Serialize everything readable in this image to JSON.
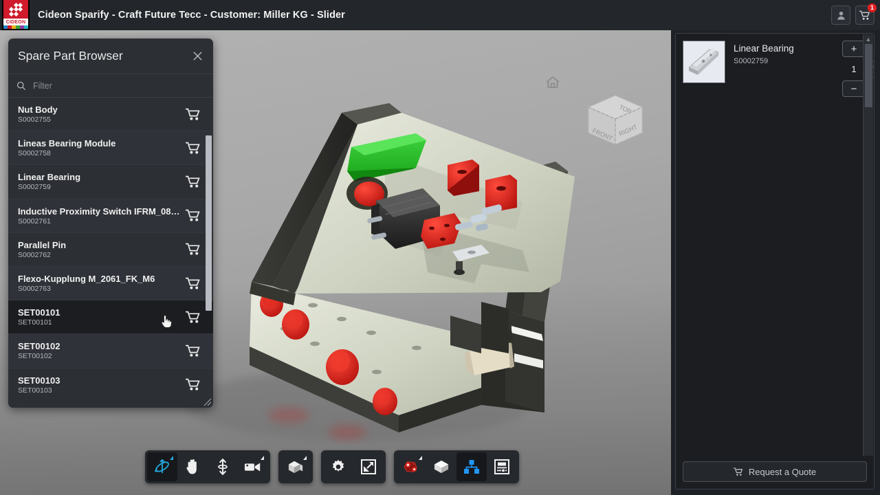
{
  "titlebar": {
    "app_title": "Cideon Sparify - Craft Future Tecc - Customer: Miller KG - Slider",
    "logo_word": "CIDEON",
    "user_button_name": "user-account-button",
    "cart_button_name": "cart-button",
    "cart_badge_count": "1"
  },
  "browser": {
    "title": "Spare Part Browser",
    "close_label": "✕",
    "filter_placeholder": "Filter",
    "filter_value": "",
    "parts": [
      {
        "name": "Nut Body",
        "id": "S0002755",
        "selected": false
      },
      {
        "name": "Lineas Bearing Module",
        "id": "S0002758",
        "selected": false
      },
      {
        "name": "Linear Bearing",
        "id": "S0002759",
        "selected": false
      },
      {
        "name": "Inductive Proximity Switch IFRM_08…",
        "id": "S0002761",
        "selected": false
      },
      {
        "name": "Parallel Pin",
        "id": "S0002762",
        "selected": false
      },
      {
        "name": "Flexo-Kupplung M_2061_FK_M6",
        "id": "S0002763",
        "selected": false
      },
      {
        "name": "SET00101",
        "id": "SET00101",
        "selected": true
      },
      {
        "name": "SET00102",
        "id": "SET00102",
        "selected": false
      },
      {
        "name": "SET00103",
        "id": "SET00103",
        "selected": false
      }
    ]
  },
  "viewport": {
    "home_icon": "home-icon",
    "viewcube": {
      "top": "TOP",
      "front": "FRONT",
      "right": "RIGHT"
    }
  },
  "toolbar": {
    "groups": [
      {
        "name": "navigation-tools",
        "buttons": [
          {
            "name": "orbit-tool",
            "icon": "orbit-icon",
            "active": true,
            "accent": true,
            "has_dropdown": true
          },
          {
            "name": "pan-tool",
            "icon": "hand-icon",
            "active": false,
            "accent": false,
            "has_dropdown": false
          },
          {
            "name": "zoom-tool",
            "icon": "zoom-vertical-arrow-icon",
            "active": false,
            "accent": false,
            "has_dropdown": false
          },
          {
            "name": "camera-tool",
            "icon": "camera-icon",
            "active": false,
            "accent": false,
            "has_dropdown": true
          }
        ]
      },
      {
        "name": "view-style-tools",
        "buttons": [
          {
            "name": "display-mode-tool",
            "icon": "shaded-box-icon",
            "active": false,
            "accent": false,
            "has_dropdown": true
          }
        ]
      },
      {
        "name": "settings-tools",
        "buttons": [
          {
            "name": "settings-tool",
            "icon": "gear-icon",
            "active": false,
            "accent": false,
            "has_dropdown": false
          },
          {
            "name": "fullscreen-tool",
            "icon": "expand-arrow-icon",
            "active": false,
            "accent": false,
            "has_dropdown": false
          }
        ]
      },
      {
        "name": "model-tools",
        "buttons": [
          {
            "name": "explode-tool",
            "icon": "explode-parts-icon",
            "active": false,
            "accent": false,
            "has_dropdown": true
          },
          {
            "name": "isolate-tool",
            "icon": "cube-icon",
            "active": false,
            "accent": false,
            "has_dropdown": false
          },
          {
            "name": "structure-tree-tool",
            "icon": "structure-tree-icon",
            "active": true,
            "accent": true,
            "has_dropdown": false
          },
          {
            "name": "properties-tool",
            "icon": "properties-panel-icon",
            "active": false,
            "accent": false,
            "has_dropdown": false
          }
        ]
      }
    ]
  },
  "cart": {
    "items": [
      {
        "name": "Linear Bearing",
        "id": "S0002759",
        "quantity": "1",
        "thumbnail": "linear-bearing-rail"
      }
    ],
    "increase_label": "+",
    "decrease_label": "−",
    "delete_name": "trash-icon",
    "quote_label": "Request a Quote"
  },
  "colors": {
    "accent_blue": "#25a9e0",
    "brand_red": "#cf1b2b",
    "badge_red": "#e02020",
    "panel_dark": "#2c2f34",
    "cart_panel_dark": "#1b1d21",
    "titlebar": "#23262b"
  }
}
